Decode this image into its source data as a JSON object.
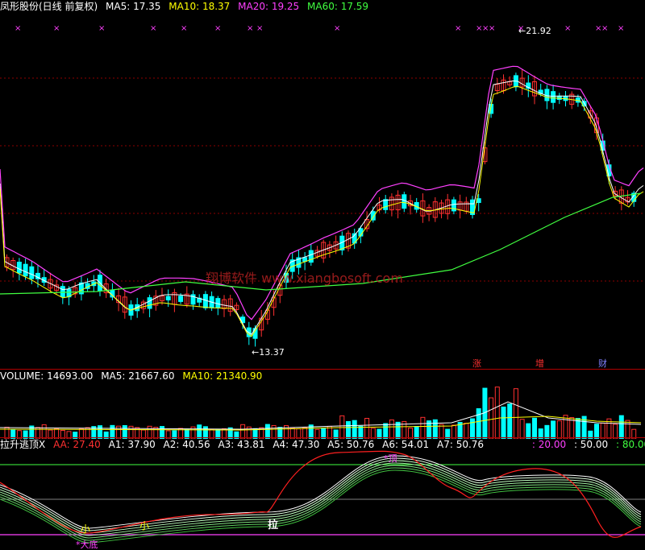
{
  "price_pane": {
    "title": "凤形股份(日线 前复权)",
    "ma5_label": "MA5: 17.35",
    "ma10_label": "MA10: 18.37",
    "ma20_label": "MA20: 19.25",
    "ma60_label": "MA60: 17.59",
    "high_marker": "21.92",
    "low_marker": "13.37",
    "watermark": "翔博软件 www.xiangbosoft.com",
    "tags": [
      "涨",
      "增",
      "财"
    ]
  },
  "volume_pane": {
    "title": "VOLUME: 14693.00",
    "ma5_label": "MA5: 21667.60",
    "ma10_label": "MA10: 21340.90"
  },
  "indicator_pane": {
    "title": "拉升逃顶X",
    "aa": "AA: 27.40",
    "a1": "A1: 37.90",
    "a2": "A2: 40.56",
    "a3": "A3: 43.81",
    "a4": "A4: 47.30",
    "a5": "A5: 50.76",
    "a6": "A6: 54.01",
    "a7": "A7: 50.76",
    "lv1": ": 20.00",
    "lv2": ": 50.00",
    "lv3": ": 80.00",
    "marks": [
      "小",
      "小",
      "拉",
      "*顶",
      "*大底"
    ]
  },
  "colors": {
    "up": "#ff3030",
    "down": "#00ffff",
    "ma5": "#ffffff",
    "ma10": "#ffff00",
    "ma20": "#ff40ff",
    "ma60": "#40ff40",
    "grid": "#8b0000"
  }
}
